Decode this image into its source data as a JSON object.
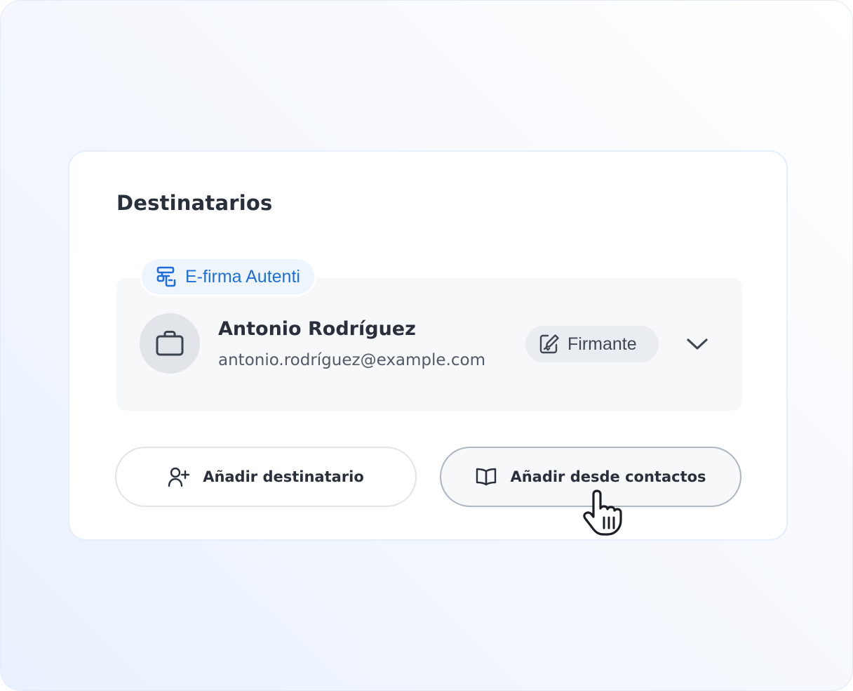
{
  "section": {
    "title": "Destinatarios"
  },
  "recipient": {
    "tag_label": "E-firma Autenti",
    "name": "Antonio Rodríguez",
    "email": "antonio.rodríguez@example.com",
    "role_label": "Firmante"
  },
  "actions": {
    "add_recipient_label": "Añadir destinatario",
    "add_from_contacts_label": "Añadir desde contactos"
  },
  "colors": {
    "accent": "#1f6fd8",
    "text": "#2a303b",
    "muted_text": "#525a66"
  },
  "icons": {
    "tag": "autenti-signature-icon",
    "avatar": "briefcase-icon",
    "role": "signature-pen-icon",
    "expand": "chevron-down-icon",
    "add_recipient": "user-plus-icon",
    "add_from_contacts": "book-open-icon",
    "pointer": "hand-pointer-cursor-icon"
  }
}
